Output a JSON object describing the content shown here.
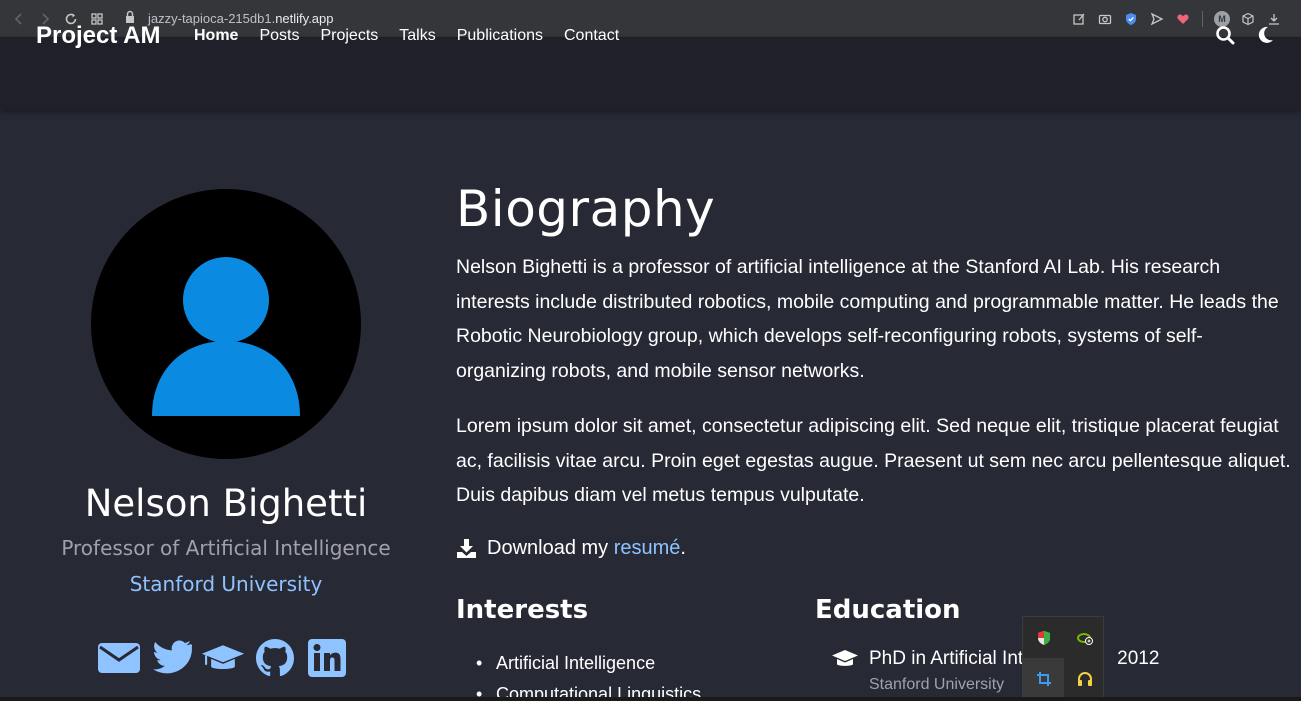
{
  "browser": {
    "url_prefix": "jazzy-tapioca-215db1.",
    "url_host": "netlify.app",
    "profile_initial": "M",
    "icons": [
      "back-icon",
      "forward-icon",
      "reload-icon",
      "apps-icon",
      "lock-icon",
      "share-icon",
      "screenshot-icon",
      "shield-extension-icon",
      "send-icon",
      "heart-icon",
      "profile-icon",
      "box-extension-icon",
      "download-icon"
    ]
  },
  "site": {
    "brand": "Project AM",
    "menu": [
      "Home",
      "Posts",
      "Projects",
      "Talks",
      "Publications",
      "Contact"
    ],
    "active_menu": "Home"
  },
  "profile": {
    "name": "Nelson Bighetti",
    "role": "Professor of Artificial Intelligence",
    "organization": "Stanford University",
    "avatar_color": "#0a8ae0",
    "social": [
      "email-icon",
      "twitter-icon",
      "graduation-cap-icon",
      "github-icon",
      "linkedin-icon"
    ],
    "social_color": "#8fc3ff"
  },
  "biography": {
    "title": "Biography",
    "paragraph1": "Nelson Bighetti is a professor of artificial intelligence at the Stanford AI Lab. His research interests include distributed robotics, mobile computing and programmable matter. He leads the Robotic Neurobiology group, which develops self-reconfiguring robots, systems of self-organizing robots, and mobile sensor networks.",
    "paragraph2": "Lorem ipsum dolor sit amet, consectetur adipiscing elit. Sed neque elit, tristique placerat feugiat ac, facilisis vitae arcu. Proin eget egestas augue. Praesent ut sem nec arcu pellentesque aliquet. Duis dapibus diam vel metus tempus vulputate.",
    "download_prefix": "Download my ",
    "download_link": "resumé",
    "download_suffix": "."
  },
  "interests": {
    "title": "Interests",
    "items": [
      "Artificial Intelligence",
      "Computational Linguistics"
    ]
  },
  "education": {
    "title": "Education",
    "degree_visible_start": "PhD in Artificial Int",
    "degree_visible_end": "2012",
    "school": "Stanford University"
  },
  "accent_color": "#8fc3ff",
  "background_color": "#272935"
}
